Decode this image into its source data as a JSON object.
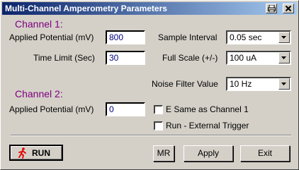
{
  "window": {
    "title": "Multi-Channel Amperometry Parameters"
  },
  "channel1": {
    "heading": "Channel 1:",
    "applied_potential_label": "Applied Potential (mV)",
    "applied_potential_value": "800",
    "time_limit_label": "Time Limit (Sec)",
    "time_limit_value": "30"
  },
  "channel2": {
    "heading": "Channel 2:",
    "applied_potential_label": "Applied Potential (mV)",
    "applied_potential_value": "0"
  },
  "settings": {
    "sample_interval_label": "Sample Interval",
    "sample_interval_value": "0.05 sec",
    "full_scale_label": "Full Scale (+/-)",
    "full_scale_value": "100 uA",
    "noise_filter_label": "Noise Filter Value",
    "noise_filter_value": "10 Hz"
  },
  "options": {
    "same_as_channel1_label": "E Same as Channel 1",
    "same_as_channel1_checked": false,
    "external_trigger_label": "Run - External Trigger",
    "external_trigger_checked": false
  },
  "buttons": {
    "run": "RUN",
    "mr": "MR",
    "apply": "Apply",
    "exit": "Exit"
  },
  "colors": {
    "section_heading": "#800080",
    "field_text": "#000080",
    "run_icon": "#e00000",
    "titlebar_start": "#0a246a",
    "titlebar_end": "#a6caf0"
  },
  "icons": {
    "run": "running-man-icon",
    "print": "printer-icon",
    "close": "close-icon",
    "dropdown": "chevron-down-icon"
  }
}
